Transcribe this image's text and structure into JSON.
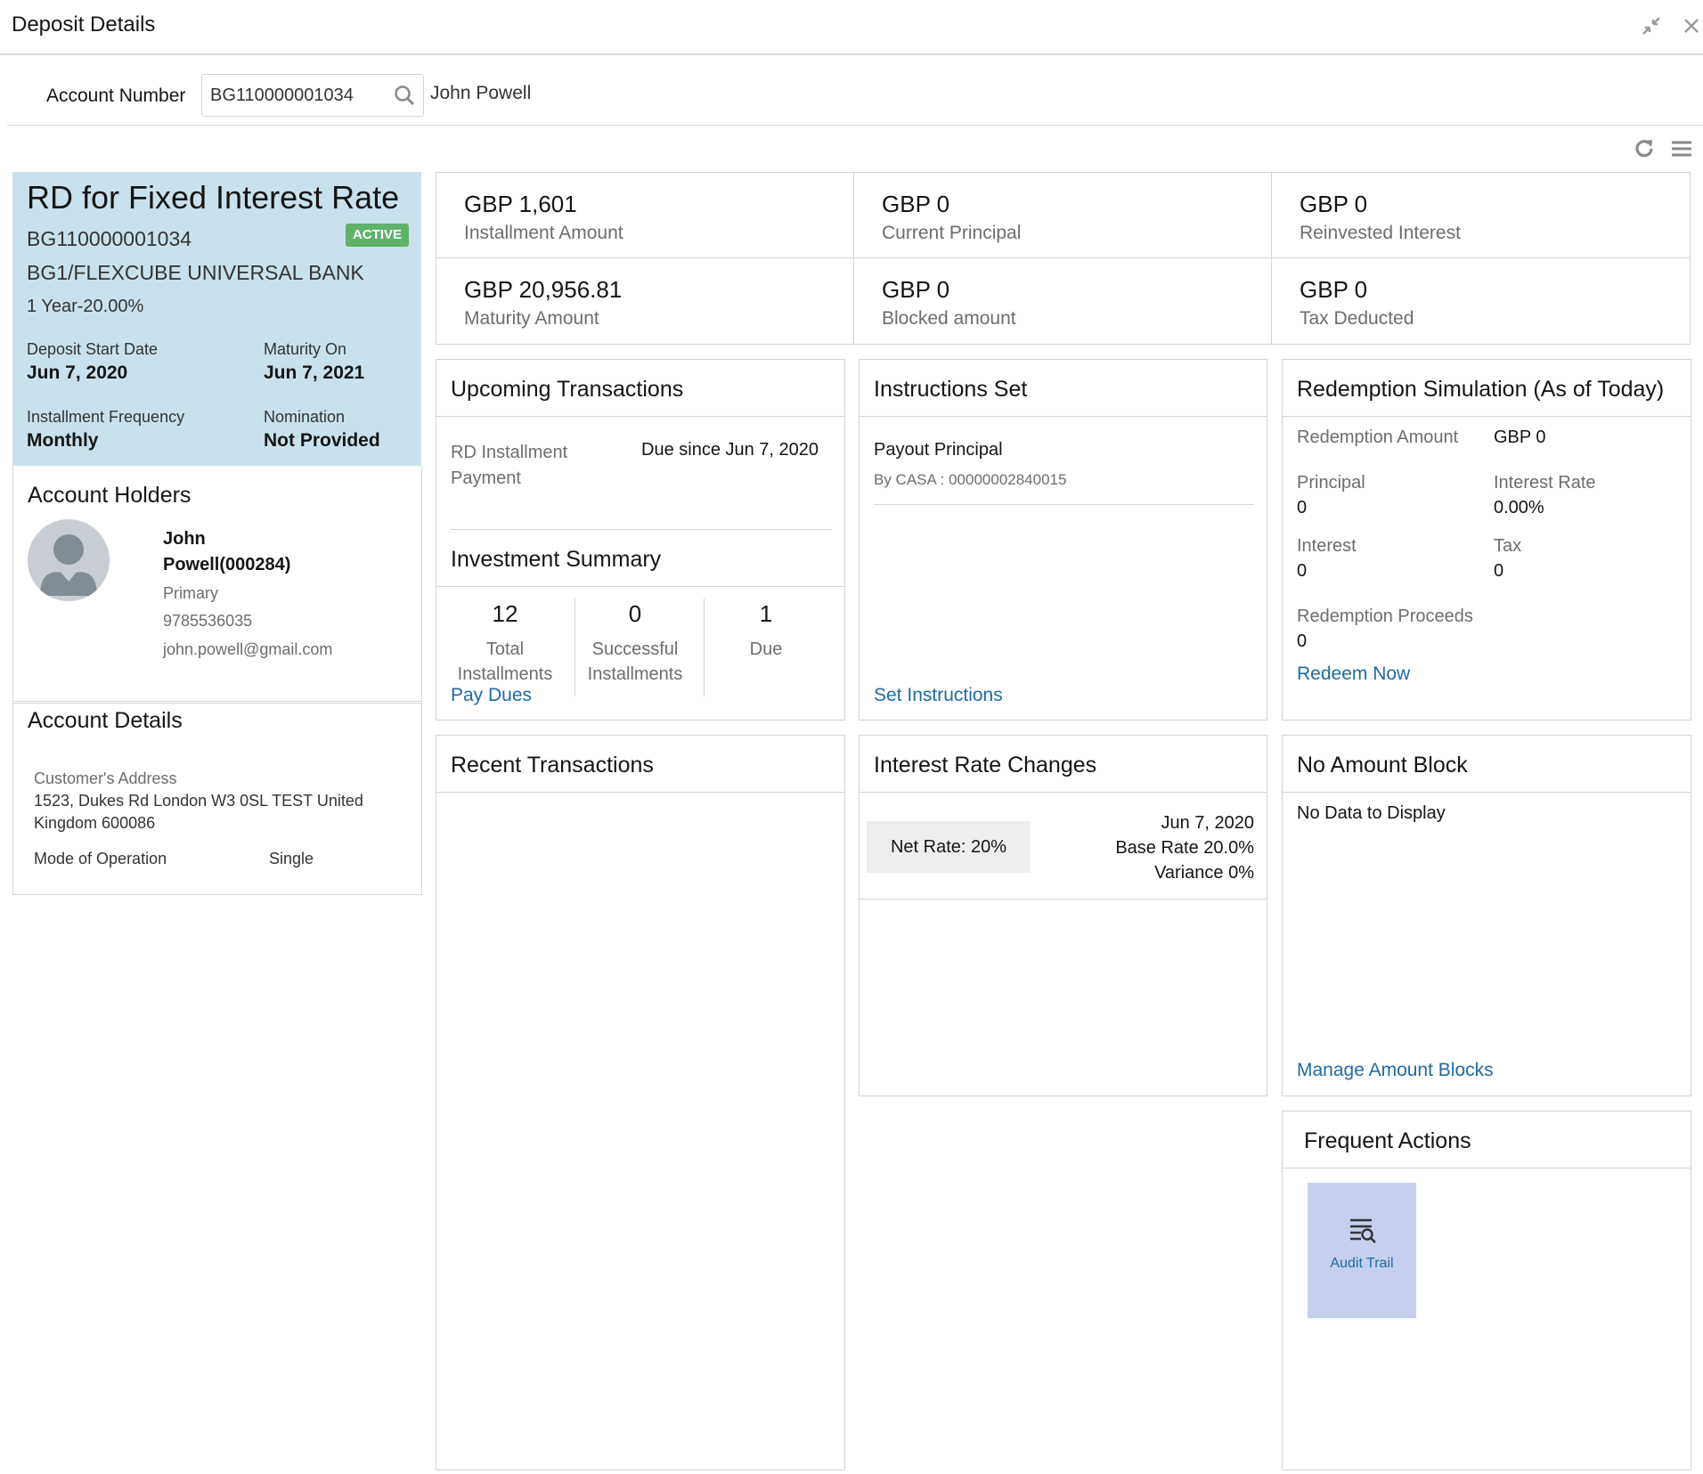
{
  "header": {
    "title": "Deposit Details",
    "minimize_icon": "compress-icon",
    "close_icon": "close-icon"
  },
  "account_bar": {
    "label": "Account Number",
    "value": "BG110000001034",
    "customer_name": "John Powell"
  },
  "toolbar": {
    "refresh_icon": "refresh-icon",
    "menu_icon": "hamburger-menu-icon"
  },
  "account_card": {
    "title": "RD for Fixed Interest Rate",
    "account_no": "BG110000001034",
    "status": "ACTIVE",
    "bank": "BG1/FLEXCUBE UNIVERSAL BANK",
    "term": "1 Year-20.00%",
    "start_label": "Deposit Start Date",
    "start_value": "Jun 7, 2020",
    "maturity_label": "Maturity On",
    "maturity_value": "Jun 7, 2021",
    "freq_label": "Installment Frequency",
    "freq_value": "Monthly",
    "nomination_label": "Nomination",
    "nomination_value": "Not Provided",
    "status_color": "#5fb26b",
    "card_color": "#c9e1ec"
  },
  "account_holders": {
    "title": "Account Holders",
    "name_line1": "John",
    "name_line2": "Powell(000284)",
    "role": "Primary",
    "phone": "9785536035",
    "email": "john.powell@gmail.com"
  },
  "account_details": {
    "title": "Account Details",
    "address_label": "Customer's Address",
    "address_line1": "1523, Dukes Rd London W3 0SL TEST United",
    "address_line2": "Kingdom 600086",
    "mode_label": "Mode of Operation",
    "mode_value": "Single"
  },
  "summary": {
    "tiles": [
      {
        "value": "GBP 1,601",
        "label": "Installment Amount"
      },
      {
        "value": "GBP 0",
        "label": "Current Principal"
      },
      {
        "value": "GBP 0",
        "label": "Reinvested Interest"
      },
      {
        "value": "GBP 20,956.81",
        "label": "Maturity Amount"
      },
      {
        "value": "GBP 0",
        "label": "Blocked amount"
      },
      {
        "value": "GBP 0",
        "label": "Tax Deducted"
      }
    ]
  },
  "upcoming": {
    "title": "Upcoming Transactions",
    "item_label_1": "RD Installment",
    "item_label_2": "Payment",
    "item_due": "Due since Jun 7, 2020"
  },
  "investment_summary": {
    "title": "Investment Summary",
    "stats": [
      {
        "value": "12",
        "label1": "Total",
        "label2": "Installments"
      },
      {
        "value": "0",
        "label1": "Successful",
        "label2": "Installments"
      },
      {
        "value": "1",
        "label1": "Due",
        "label2": ""
      }
    ],
    "pay_dues": "Pay Dues"
  },
  "instructions": {
    "title": "Instructions Set",
    "item_title": "Payout Principal",
    "item_sub": "By CASA : 00000002840015",
    "link": "Set Instructions"
  },
  "redemption": {
    "title": "Redemption Simulation (As of Today)",
    "amount_label": "Redemption Amount",
    "amount_value": "GBP 0",
    "principal_label": "Principal",
    "principal_value": "0",
    "rate_label": "Interest Rate",
    "rate_value": "0.00%",
    "interest_label": "Interest",
    "interest_value": "0",
    "tax_label": "Tax",
    "tax_value": "0",
    "proceeds_label": "Redemption Proceeds",
    "proceeds_value": "0",
    "link": "Redeem Now"
  },
  "recent": {
    "title": "Recent Transactions"
  },
  "rate_changes": {
    "title": "Interest Rate Changes",
    "net_rate": "Net Rate: 20%",
    "date": "Jun 7, 2020",
    "base_rate": "Base Rate 20.0%",
    "variance": "Variance 0%"
  },
  "amount_block": {
    "title": "No Amount Block",
    "empty": "No Data to Display",
    "link": "Manage Amount Blocks"
  },
  "frequent_actions": {
    "title": "Frequent Actions",
    "action_label": "Audit Trail",
    "action_icon": "audit-trail-icon",
    "action_color": "#c6cfee"
  }
}
